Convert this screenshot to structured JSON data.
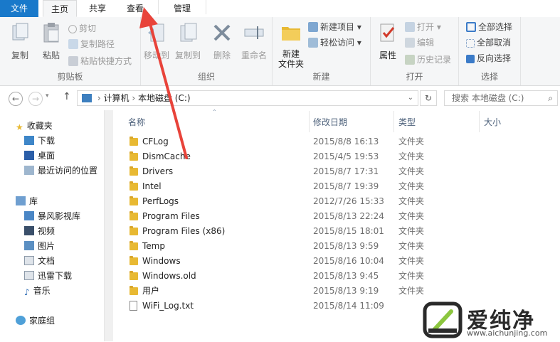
{
  "tabs": {
    "file": "文件",
    "home": "主页",
    "share": "共享",
    "view": "查看",
    "manage": "管理"
  },
  "ribbon": {
    "clipboard": {
      "label": "剪贴板",
      "copy": "复制",
      "paste": "粘贴",
      "cut": "剪切",
      "copy_path": "复制路径",
      "paste_shortcut": "粘贴快捷方式"
    },
    "organize": {
      "label": "组织",
      "move_to": "移动到",
      "copy_to": "复制到",
      "delete": "删除",
      "rename": "重命名"
    },
    "new": {
      "label": "新建",
      "new_folder": "新建\n文件夹",
      "new_item": "新建项目",
      "easy_access": "轻松访问"
    },
    "open": {
      "label": "打开",
      "properties": "属性",
      "open": "打开",
      "edit": "编辑",
      "history": "历史记录"
    },
    "select": {
      "label": "选择",
      "select_all": "全部选择",
      "select_none": "全部取消",
      "invert": "反向选择"
    }
  },
  "address": {
    "computer": "计算机",
    "drive": "本地磁盘 (C:)",
    "search_placeholder": "搜索 本地磁盘 (C:)"
  },
  "nav": {
    "favorites": "收藏夹",
    "downloads": "下载",
    "desktop": "桌面",
    "recent": "最近访问的位置",
    "libraries": "库",
    "baofeng": "暴风影视库",
    "videos": "视频",
    "pictures": "图片",
    "documents": "文档",
    "xunlei": "迅雷下载",
    "music": "音乐",
    "homegroup": "家庭组"
  },
  "columns": {
    "name": "名称",
    "date": "修改日期",
    "type": "类型",
    "size": "大小"
  },
  "files": [
    {
      "name": "CFLog",
      "date": "2015/8/8 16:13",
      "type": "文件夹",
      "kind": "folder"
    },
    {
      "name": "DismCache",
      "date": "2015/4/5 19:53",
      "type": "文件夹",
      "kind": "folder"
    },
    {
      "name": "Drivers",
      "date": "2015/8/7 17:31",
      "type": "文件夹",
      "kind": "folder"
    },
    {
      "name": "Intel",
      "date": "2015/8/7 19:39",
      "type": "文件夹",
      "kind": "folder"
    },
    {
      "name": "PerfLogs",
      "date": "2012/7/26 15:33",
      "type": "文件夹",
      "kind": "folder"
    },
    {
      "name": "Program Files",
      "date": "2015/8/13 22:24",
      "type": "文件夹",
      "kind": "folder"
    },
    {
      "name": "Program Files (x86)",
      "date": "2015/8/15 18:01",
      "type": "文件夹",
      "kind": "folder"
    },
    {
      "name": "Temp",
      "date": "2015/8/13 9:59",
      "type": "文件夹",
      "kind": "folder"
    },
    {
      "name": "Windows",
      "date": "2015/8/16 10:04",
      "type": "文件夹",
      "kind": "folder"
    },
    {
      "name": "Windows.old",
      "date": "2015/8/13 9:45",
      "type": "文件夹",
      "kind": "folder"
    },
    {
      "name": "用户",
      "date": "2015/8/13 9:19",
      "type": "文件夹",
      "kind": "folder"
    },
    {
      "name": "WiFi_Log.txt",
      "date": "2015/8/14 11:09",
      "type": "",
      "kind": "file"
    }
  ],
  "watermark": {
    "brand": "爱纯净",
    "url": "www.aichunjing.com"
  }
}
